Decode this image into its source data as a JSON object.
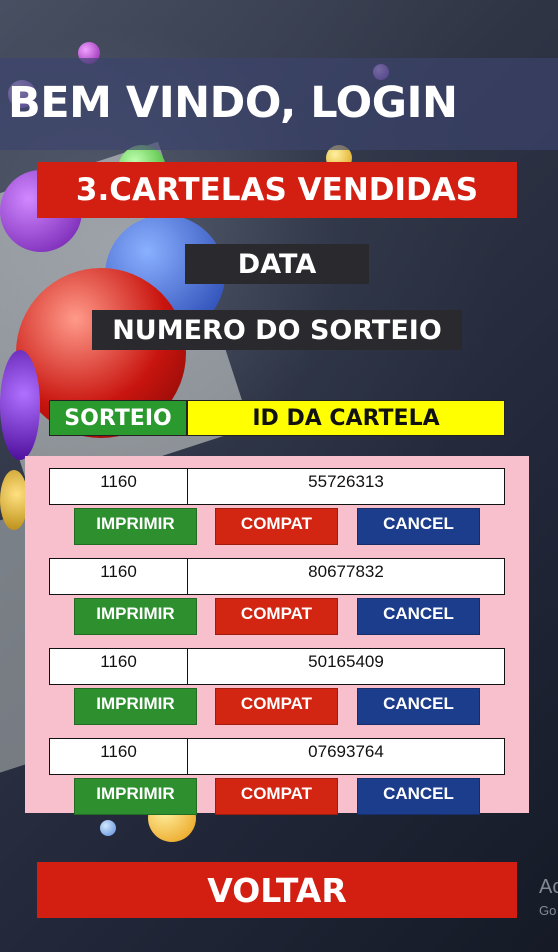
{
  "header": {
    "welcome_text": "BEM VINDO, LOGIN"
  },
  "main": {
    "title": "3.CARTELAS VENDIDAS",
    "date_label": "DATA",
    "draw_number_label": "NUMERO DO SORTEIO"
  },
  "table": {
    "headers": {
      "sorteio": "SORTEIO",
      "cartela_id": "ID DA CARTELA"
    },
    "rows": [
      {
        "sorteio": "1160",
        "cartela_id": "55726313"
      },
      {
        "sorteio": "1160",
        "cartela_id": "80677832"
      },
      {
        "sorteio": "1160",
        "cartela_id": "50165409"
      },
      {
        "sorteio": "1160",
        "cartela_id": "07693764"
      }
    ],
    "actions": {
      "print": "IMPRIMIR",
      "compat": "COMPAT",
      "cancel": "CANCEL"
    }
  },
  "footer": {
    "back_label": "VOLTAR"
  },
  "watermark": {
    "line1": "Ac",
    "line2": "Go"
  },
  "colors": {
    "title_red": "#d31e12",
    "sorteio_green": "#2a9a2e",
    "cartela_yellow": "#ffff00",
    "panel_pink": "#f8c0cc",
    "print_green": "#2e8f2f",
    "compat_red": "#d32612",
    "cancel_blue": "#1c3d8c"
  }
}
